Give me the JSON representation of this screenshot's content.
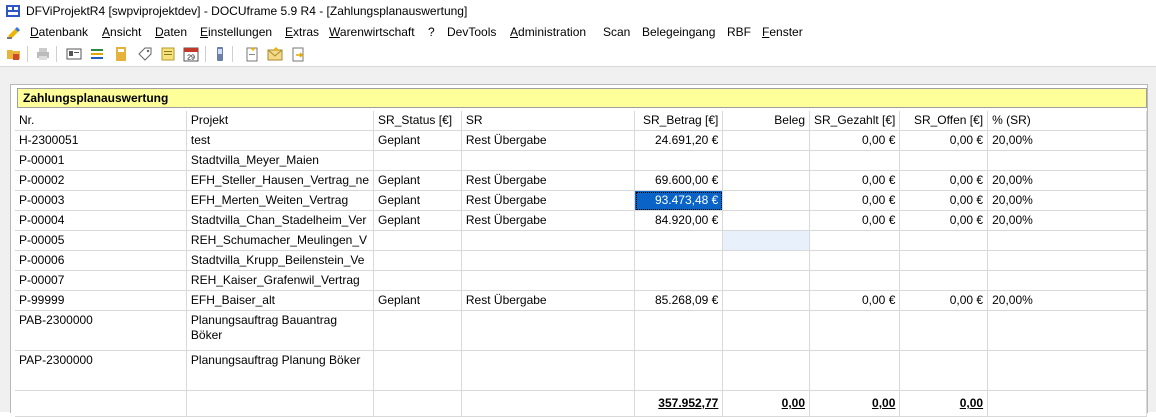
{
  "window": {
    "title": "DFViProjektR4 [swpviprojektdev] - DOCUframe 5.9 R4 - [Zahlungsplanauswertung]"
  },
  "menu": {
    "items": [
      {
        "pre": "",
        "u": "D",
        "post": "atenbank"
      },
      {
        "pre": "",
        "u": "A",
        "post": "nsicht"
      },
      {
        "pre": "",
        "u": "D",
        "post": "aten"
      },
      {
        "pre": "",
        "u": "E",
        "post": "instellungen"
      },
      {
        "pre": "",
        "u": "E",
        "post": "xtras"
      },
      {
        "pre": "",
        "u": "W",
        "post": "arenwirtschaft"
      },
      {
        "pre": "?",
        "u": "",
        "post": ""
      },
      {
        "pre": "DevTools",
        "u": "",
        "post": ""
      },
      {
        "pre": "",
        "u": "A",
        "post": "dministration"
      },
      {
        "pre": "Scan",
        "u": "",
        "post": ""
      },
      {
        "pre": "Belegeingang",
        "u": "",
        "post": ""
      },
      {
        "pre": "RBF",
        "u": "",
        "post": ""
      },
      {
        "pre": "",
        "u": "F",
        "post": "enster"
      }
    ]
  },
  "panel": {
    "caption": "Zahlungsplanauswertung"
  },
  "grid": {
    "headers": [
      "Nr.",
      "Projekt",
      "SR_Status [€]",
      "SR",
      "SR_Betrag [€]",
      "Beleg",
      "SR_Gezahlt [€]",
      "SR_Offen [€]",
      "% (SR)"
    ],
    "rows": [
      [
        "H-2300051",
        "test",
        "Geplant",
        "Rest Übergabe",
        "24.691,20 €",
        "",
        "0,00 €",
        "0,00 €",
        "20,00%"
      ],
      [
        "P-00001",
        "Stadtvilla_Meyer_Maien",
        "",
        "",
        "",
        "",
        "",
        "",
        ""
      ],
      [
        "P-00002",
        "EFH_Steller_Hausen_Vertrag_ne",
        "Geplant",
        "Rest Übergabe",
        "69.600,00 €",
        "",
        "0,00 €",
        "0,00 €",
        "20,00%"
      ],
      [
        "P-00003",
        "EFH_Merten_Weiten_Vertrag",
        "Geplant",
        "Rest Übergabe",
        "93.473,48 €",
        "",
        "0,00 €",
        "0,00 €",
        "20,00%"
      ],
      [
        "P-00004",
        "Stadtvilla_Chan_Stadelheim_Ver",
        "Geplant",
        "Rest Übergabe",
        "84.920,00 €",
        "",
        "0,00 €",
        "0,00 €",
        "20,00%"
      ],
      [
        "P-00005",
        "REH_Schumacher_Meulingen_V",
        "",
        "",
        "",
        "",
        "",
        "",
        ""
      ],
      [
        "P-00006",
        "Stadtvilla_Krupp_Beilenstein_Ve",
        "",
        "",
        "",
        "",
        "",
        "",
        ""
      ],
      [
        "P-00007",
        "REH_Kaiser_Grafenwil_Vertrag",
        "",
        "",
        "",
        "",
        "",
        "",
        ""
      ],
      [
        "P-99999",
        "EFH_Baiser_alt",
        "Geplant",
        "Rest Übergabe",
        "85.268,09 €",
        "",
        "0,00 €",
        "0,00 €",
        "20,00%"
      ],
      [
        "PAB-2300000",
        "Planungsauftrag Bauantrag Böker",
        "",
        "",
        "",
        "",
        "",
        "",
        ""
      ],
      [
        "PAP-2300000",
        "Planungsauftrag Planung Böker",
        "",
        "",
        "",
        "",
        "",
        "",
        ""
      ]
    ],
    "totals": [
      "",
      "",
      "",
      "",
      "357.952,77",
      "0,00",
      "0,00",
      "0,00",
      ""
    ]
  },
  "colors": {
    "caption_bg": "#ffff99",
    "selection": "#0a64c8",
    "accent": "#1e6fd9"
  },
  "icons": [
    "app-icon",
    "menu-doc-icon",
    "open-folder-icon",
    "print-icon",
    "card-icon",
    "list-icon",
    "notebook-icon",
    "tag-icon",
    "note-icon",
    "calendar-icon",
    "phone-icon",
    "new-doc-icon",
    "mail-icon",
    "export-icon"
  ]
}
